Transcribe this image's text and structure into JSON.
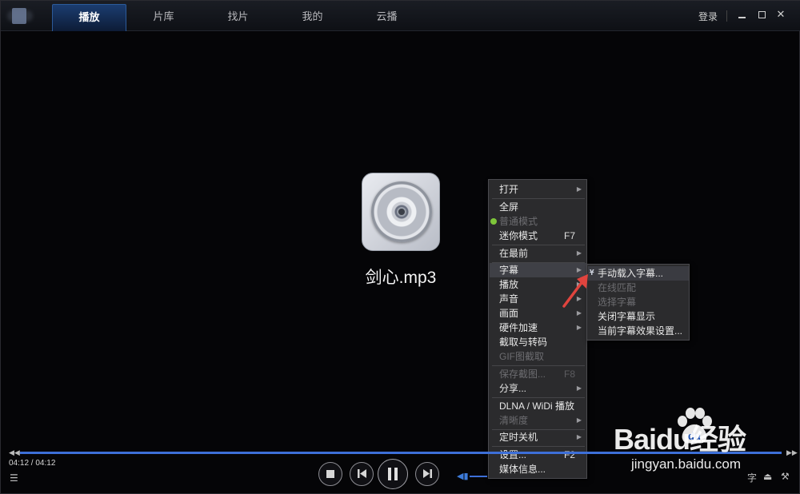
{
  "tabs": [
    {
      "label": "播放",
      "active": true
    },
    {
      "label": "片库",
      "active": false
    },
    {
      "label": "找片",
      "active": false
    },
    {
      "label": "我的",
      "active": false
    },
    {
      "label": "云播",
      "active": false
    }
  ],
  "header": {
    "login_label": "登录"
  },
  "media": {
    "filename": "剑心.mp3"
  },
  "context_menu": {
    "items": [
      {
        "label": "打开",
        "submenu": true,
        "disabled": false
      },
      {
        "label": "全屏",
        "disabled": false
      },
      {
        "label": "普通模式",
        "disabled": true,
        "checked": true
      },
      {
        "label": "迷你模式",
        "shortcut": "F7",
        "disabled": false
      },
      {
        "label": "在最前",
        "submenu": true,
        "disabled": false
      },
      {
        "label": "字幕",
        "submenu": true,
        "disabled": false,
        "highlighted": true
      },
      {
        "label": "播放",
        "submenu": true,
        "disabled": false
      },
      {
        "label": "声音",
        "submenu": true,
        "disabled": false
      },
      {
        "label": "画面",
        "submenu": true,
        "disabled": false
      },
      {
        "label": "硬件加速",
        "submenu": true,
        "disabled": false
      },
      {
        "label": "截取与转码",
        "disabled": false
      },
      {
        "label": "GIF图截取",
        "disabled": true
      },
      {
        "label": "保存截图...",
        "shortcut": "F8",
        "disabled": true
      },
      {
        "label": "分享...",
        "submenu": true,
        "disabled": false
      },
      {
        "label": "DLNA / WiDi 播放",
        "disabled": false
      },
      {
        "label": "清晰度",
        "submenu": true,
        "disabled": true
      },
      {
        "label": "定时关机",
        "submenu": true,
        "disabled": false
      },
      {
        "label": "设置...",
        "shortcut": "F2",
        "disabled": false
      },
      {
        "label": "媒体信息...",
        "disabled": false
      }
    ]
  },
  "subtitle_submenu": {
    "items": [
      {
        "label": "手动载入字幕...",
        "disabled": false,
        "highlighted": true,
        "icon": "folder-icon"
      },
      {
        "label": "在线匹配",
        "disabled": true
      },
      {
        "label": "选择字幕",
        "disabled": true
      },
      {
        "label": "关闭字幕显示",
        "disabled": false
      },
      {
        "label": "当前字幕效果设置...",
        "disabled": false
      }
    ]
  },
  "playback": {
    "time_display": "04:12 / 04:12",
    "progress": 1.0,
    "volume": 0.5
  },
  "bottom_right": {
    "subtitle_label": "字"
  },
  "watermark": {
    "brand": "Baidu经验",
    "url": "jingyan.baidu.com"
  },
  "colors": {
    "accent": "#3d6fd8",
    "active_tab": "#1b3d70",
    "menu_bg": "#2b2b2d",
    "arrow": "#e0443e"
  }
}
